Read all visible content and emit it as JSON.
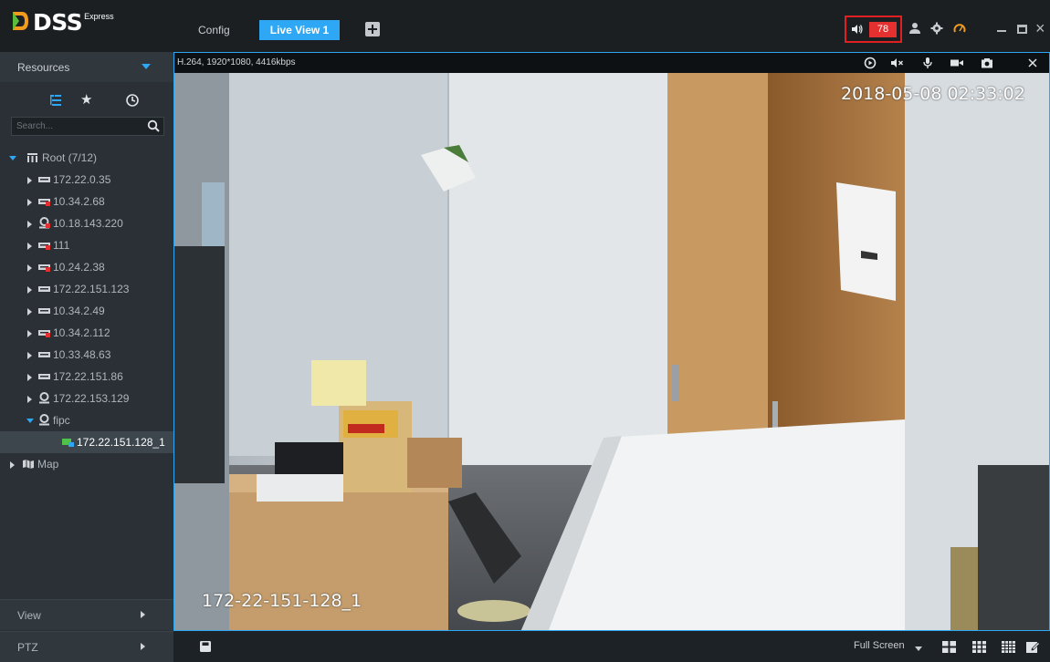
{
  "app": {
    "brand": "DSS",
    "brand_suffix": "Express"
  },
  "tabs": [
    {
      "label": "Config",
      "active": false
    },
    {
      "label": "Live View 1",
      "active": true
    }
  ],
  "header": {
    "alarm_count": "78"
  },
  "sidebar": {
    "resources_label": "Resources",
    "search_placeholder": "Search...",
    "tree": [
      {
        "label": "Root (7/12)",
        "type": "root",
        "expanded": true
      },
      {
        "label": "172.22.0.35",
        "type": "nvr"
      },
      {
        "label": "10.34.2.68",
        "type": "nvr-alarm"
      },
      {
        "label": "10.18.143.220",
        "type": "ipc-alarm"
      },
      {
        "label": "111",
        "type": "nvr-alarm"
      },
      {
        "label": "10.24.2.38",
        "type": "nvr-alarm"
      },
      {
        "label": "172.22.151.123",
        "type": "nvr"
      },
      {
        "label": "10.34.2.49",
        "type": "nvr"
      },
      {
        "label": "10.34.2.112",
        "type": "nvr-alarm"
      },
      {
        "label": "10.33.48.63",
        "type": "nvr"
      },
      {
        "label": "172.22.151.86",
        "type": "nvr"
      },
      {
        "label": "172.22.153.129",
        "type": "ipc"
      },
      {
        "label": "fipc",
        "type": "ipc",
        "expanded": true
      },
      {
        "label": "172.22.151.128_1",
        "type": "channel",
        "selected": true
      },
      {
        "label": "Map",
        "type": "map"
      }
    ],
    "view_label": "View",
    "ptz_label": "PTZ"
  },
  "video": {
    "stream_info": "H.264, 1920*1080, 4416kbps",
    "osd_time": "2018-05-08 02:33:02",
    "osd_name": "172-22-151-128_1"
  },
  "bottom": {
    "fullscreen_label": "Full Screen"
  },
  "colors": {
    "accent": "#2ea8f5",
    "alarm": "#e53030",
    "sidebar_bg": "#2a3036"
  }
}
